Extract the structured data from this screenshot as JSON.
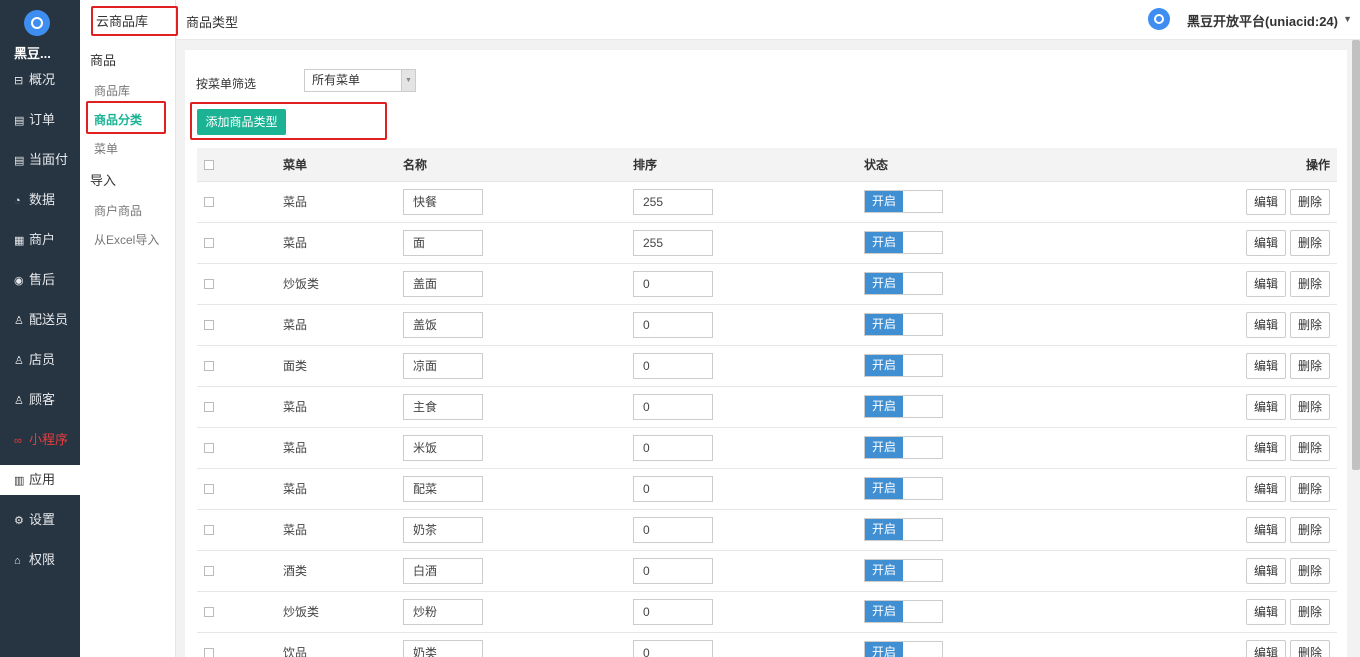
{
  "sidebar": {
    "brand": "黑豆...",
    "items": [
      {
        "icon": "⊟",
        "label": "概况"
      },
      {
        "icon": "▤",
        "label": "订单"
      },
      {
        "icon": "▤",
        "label": "当面付"
      },
      {
        "icon": "◔",
        "label": "数据"
      },
      {
        "icon": "▦",
        "label": "商户"
      },
      {
        "icon": "◉",
        "label": "售后"
      },
      {
        "icon": "♙",
        "label": "配送员"
      },
      {
        "icon": "♙",
        "label": "店员"
      },
      {
        "icon": "♙",
        "label": "顾客"
      },
      {
        "icon": "∞",
        "label": "小程序"
      },
      {
        "icon": "▥",
        "label": "应用"
      },
      {
        "icon": "⚙",
        "label": "设置"
      },
      {
        "icon": "⌂",
        "label": "权限"
      }
    ]
  },
  "subnav": {
    "title": "云商品库",
    "group1": "商品",
    "link1": "商品库",
    "link2": "商品分类",
    "link3": "菜单",
    "group2": "导入",
    "link4": "商户商品",
    "link5": "从Excel导入"
  },
  "header": {
    "page_title": "商品类型",
    "platform": "黑豆开放平台(uniacid:24)"
  },
  "filter": {
    "label": "按菜单筛选",
    "selected": "所有菜单"
  },
  "add_button": "添加商品类型",
  "table": {
    "headers": [
      "菜单",
      "名称",
      "排序",
      "状态",
      "操作"
    ],
    "status_label": "开启",
    "edit_label": "编辑",
    "delete_label": "删除",
    "rows": [
      {
        "menu": "菜品",
        "name": "快餐",
        "sort": "255"
      },
      {
        "menu": "菜品",
        "name": "面",
        "sort": "255"
      },
      {
        "menu": "炒饭类",
        "name": "盖面",
        "sort": "0"
      },
      {
        "menu": "菜品",
        "name": "盖饭",
        "sort": "0"
      },
      {
        "menu": "面类",
        "name": "凉面",
        "sort": "0"
      },
      {
        "menu": "菜品",
        "name": "主食",
        "sort": "0"
      },
      {
        "menu": "菜品",
        "name": "米饭",
        "sort": "0"
      },
      {
        "menu": "菜品",
        "name": "配菜",
        "sort": "0"
      },
      {
        "menu": "菜品",
        "name": "奶茶",
        "sort": "0"
      },
      {
        "menu": "酒类",
        "name": "白酒",
        "sort": "0"
      },
      {
        "menu": "炒饭类",
        "name": "炒粉",
        "sort": "0"
      },
      {
        "menu": "饮品",
        "name": "奶类",
        "sort": "0"
      }
    ]
  },
  "colors": {
    "sidebar_bg": "#273441",
    "accent_green": "#1bb394",
    "switch_blue": "#3f8fd2",
    "highlight_red": "#e02020"
  }
}
